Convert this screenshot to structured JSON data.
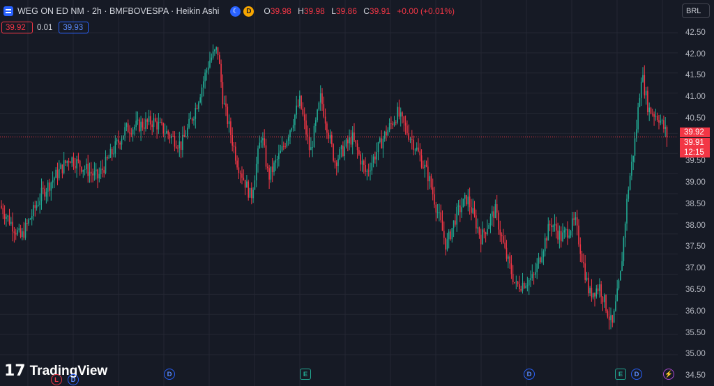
{
  "header": {
    "symbol_title": "WEG ON ED NM · 2h · BMFBOVESPA · Heikin Ashi",
    "symbol_icon": "exchange-flag-icon",
    "market_status_icon": "moon-icon",
    "delayed_badge": "D",
    "ohlc": {
      "o_key": "O",
      "o_val": "39.98",
      "h_key": "H",
      "h_val": "39.98",
      "l_key": "L",
      "l_val": "39.86",
      "c_key": "C",
      "c_val": "39.91",
      "change": "+0.00 (+0.01%)"
    },
    "sell_price": "39.92",
    "spread": "0.01",
    "buy_price": "39.93"
  },
  "currency": "BRL",
  "price_axis": {
    "ticks": [
      "42.50",
      "42.00",
      "41.50",
      "41.00",
      "40.50",
      "39.50",
      "39.00",
      "38.50",
      "38.00",
      "37.50",
      "37.00",
      "36.50",
      "36.00",
      "35.50",
      "35.00",
      "34.50"
    ],
    "current_high_label": "39.92",
    "current_close_label": "39.91",
    "countdown": "12:15"
  },
  "branding": {
    "logo_mark": "17",
    "name": "TradingView"
  },
  "events": {
    "dividend": "D",
    "earnings": "E",
    "split": "⚡",
    "other": "L"
  },
  "colors": {
    "up": "#22ab94",
    "down": "#f23645",
    "background": "#161a25",
    "grid": "#242733",
    "accent": "#2962ff"
  },
  "chart_data": {
    "type": "candlestick",
    "style": "Heikin Ashi",
    "interval": "2h",
    "ylim": [
      34.5,
      42.5
    ],
    "grid": true,
    "current_price": 39.91,
    "path_points": [
      [
        0,
        38.2
      ],
      [
        30,
        37.4
      ],
      [
        60,
        38.5
      ],
      [
        100,
        39.4
      ],
      [
        140,
        38.9
      ],
      [
        180,
        40.1
      ],
      [
        220,
        40.3
      ],
      [
        260,
        39.7
      ],
      [
        280,
        40.6
      ],
      [
        300,
        41.8
      ],
      [
        312,
        42.1
      ],
      [
        320,
        40.8
      ],
      [
        340,
        39.3
      ],
      [
        360,
        38.4
      ],
      [
        375,
        40.0
      ],
      [
        385,
        38.9
      ],
      [
        405,
        39.6
      ],
      [
        430,
        40.8
      ],
      [
        445,
        39.5
      ],
      [
        460,
        40.9
      ],
      [
        480,
        39.3
      ],
      [
        505,
        39.9
      ],
      [
        525,
        39.0
      ],
      [
        550,
        39.9
      ],
      [
        570,
        40.5
      ],
      [
        595,
        39.7
      ],
      [
        615,
        38.9
      ],
      [
        640,
        37.2
      ],
      [
        655,
        38.0
      ],
      [
        670,
        38.4
      ],
      [
        690,
        37.4
      ],
      [
        710,
        38.1
      ],
      [
        725,
        37.0
      ],
      [
        740,
        36.2
      ],
      [
        765,
        36.4
      ],
      [
        790,
        37.8
      ],
      [
        805,
        37.4
      ],
      [
        825,
        37.8
      ],
      [
        845,
        36.0
      ],
      [
        860,
        36.2
      ],
      [
        878,
        35.2
      ],
      [
        890,
        36.5
      ],
      [
        900,
        38.5
      ],
      [
        912,
        40.0
      ],
      [
        920,
        41.5
      ],
      [
        930,
        40.6
      ],
      [
        945,
        40.4
      ],
      [
        958,
        39.9
      ]
    ]
  }
}
